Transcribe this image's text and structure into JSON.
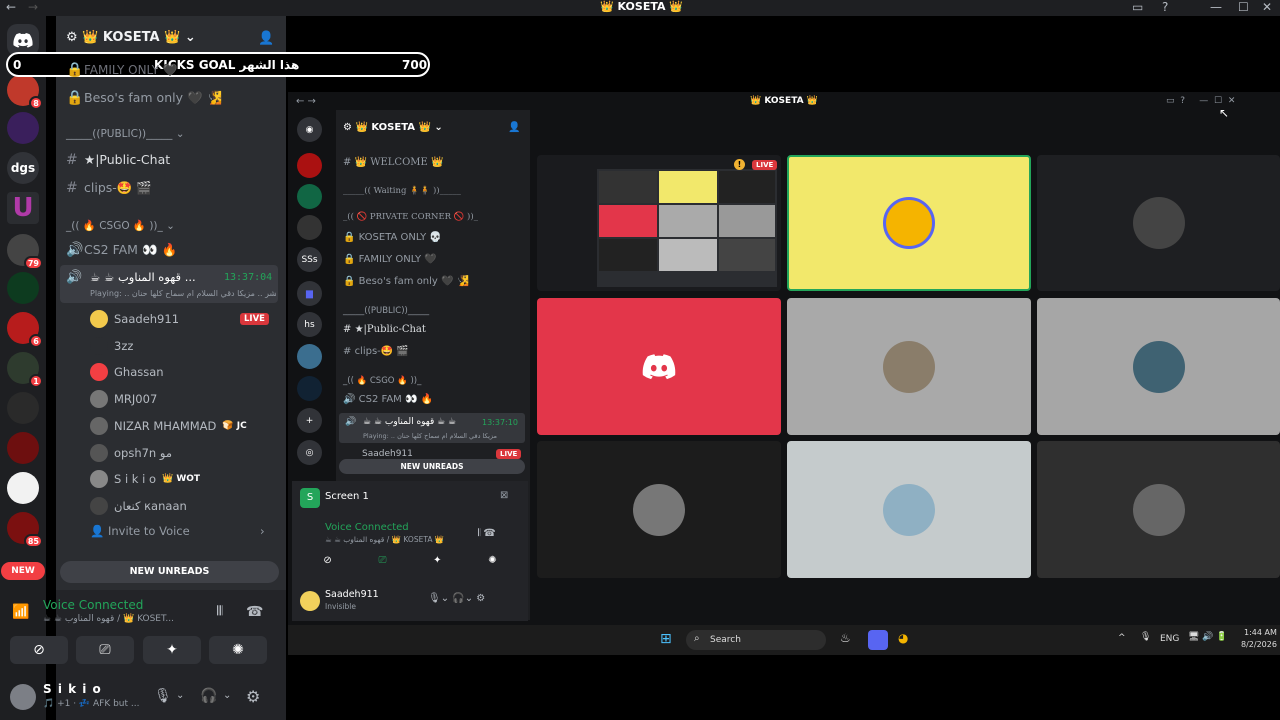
{
  "window": {
    "title": "👑 KOSETA 👑"
  },
  "goal": {
    "left": "0",
    "label": "KICKS GOAL هذا الشهر",
    "right": "700"
  },
  "server": {
    "name": "👑 KOSETA 👑"
  },
  "rail": [
    "dgs",
    "U",
    "79",
    "8",
    "6",
    "1",
    "85",
    "NEW"
  ],
  "channels": {
    "family": "FAMILY ONLY 🖤",
    "beso": "Beso's fam only 🖤 🧏",
    "public_cat": "_____((PUBLIC))_____",
    "public_chat": "★|Public-Chat",
    "clips": "clips-🤩 🎬",
    "csgo_cat": "_(( 🔥 CSGO 🔥 ))_",
    "cs2": "CS2 FAM 👀 🔥",
    "qahwa": "☕ ☕ قهوه المناوب ...",
    "qahwa_time": "13:37:04",
    "qahwa_status": "Playing: .. يا بشر .. مزيكا دقي السلام ام سماح كلها حنان",
    "invite": "Invite to Voice"
  },
  "voice_users": [
    {
      "name": "Saadeh911",
      "tag": "LIVE"
    },
    {
      "name": "3zz",
      "tag": ""
    },
    {
      "name": "Ghassan",
      "tag": ""
    },
    {
      "name": "MRJ007",
      "tag": ""
    },
    {
      "name": "NIZAR MHAMMAD",
      "tag": "🍞 JC"
    },
    {
      "name": "opsh7n مو",
      "tag": ""
    },
    {
      "name": "S i k i o",
      "tag": "👑 WOT"
    },
    {
      "name": "كنعان кanaan",
      "tag": ""
    }
  ],
  "bottom": {
    "new_unreads": "NEW UNREADS",
    "voice_connected": "Voice Connected",
    "voice_sub": "☕ ☕ قهوه المناوب / 👑 KOSET...",
    "user_name": "S i k i o",
    "user_status": "🎵 +1 · 💤 AFK but ..."
  },
  "inner": {
    "title": "👑 KOSETA 👑",
    "server": "👑 KOSETA 👑",
    "welcome": "👑 WELCOME 👑",
    "waiting": "_____(( Waiting 🧍🧍 ))_____",
    "private": "_(( 🚫 PRIVATE CORNER 🚫 ))_",
    "koseta_only": "KOSETA ONLY 💀",
    "family": "FAMILY ONLY 🖤",
    "beso": "Beso's fam only 🖤 🧏",
    "public_cat": "_____((PUBLIC))_____",
    "public_chat": "★|Public-Chat",
    "clips": "clips-🤩 🎬",
    "csgo_cat": "_(( 🔥 CSGO 🔥 ))_",
    "cs2": "CS2 FAM 👀 🔥",
    "qahwa": "☕ ☕ قهوه المناوب ☕ ☕",
    "qahwa_time": "13:37:10",
    "qahwa_status": "Playing: .. مزيكا دقي السلام ام سماح كلها حنان",
    "saadeh": "Saadeh911",
    "live": "LIVE",
    "new_unreads": "NEW UNREADS",
    "screen": "Screen 1",
    "voice_connected": "Voice Connected",
    "voice_sub": "☕ ☕ قهوه المناوب / 👑 KOSETA 👑",
    "user": "Saadeh911",
    "user_status": "Invisible",
    "search": "Search",
    "lang": "ENG",
    "time": "1:44 AM",
    "date": "8/2/2026",
    "rail": [
      "SSs",
      "hs"
    ]
  },
  "colors": {
    "accent": "#5865f2",
    "live": "#da373c",
    "green": "#23a55a",
    "yellow": "#f2e86b",
    "red": "#e3364a"
  }
}
